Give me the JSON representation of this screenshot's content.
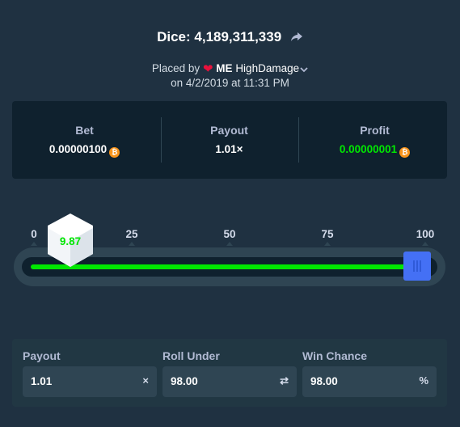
{
  "header": {
    "title": "Dice: 4,189,311,339",
    "placed_prefix": "Placed by",
    "vip_badge": "ME",
    "username": "HighDamage",
    "date_line": "on 4/2/2019 at 11:31 PM"
  },
  "stats": {
    "bet_label": "Bet",
    "bet_value": "0.00000100",
    "payout_label": "Payout",
    "payout_value": "1.01×",
    "profit_label": "Profit",
    "profit_value": "0.00000001",
    "currency_icon": "bitcoin-icon"
  },
  "slider": {
    "ticks": [
      "0",
      "25",
      "50",
      "75",
      "100"
    ],
    "roll_under": 98.0,
    "result": "9.87",
    "win_color": "#00e701",
    "lose_color": "#e9113c"
  },
  "inputs": {
    "payout_label": "Payout",
    "payout_value": "1.01",
    "payout_icon_glyph": "×",
    "roll_under_label": "Roll Under",
    "roll_under_value": "98.00",
    "roll_under_icon_glyph": "⇄",
    "win_chance_label": "Win Chance",
    "win_chance_value": "98.00",
    "win_chance_icon_glyph": "%"
  },
  "colors": {
    "background": "#1f3141",
    "panel": "#0f212e",
    "accent_green": "#00e701",
    "handle_blue": "#4470f5",
    "bitcoin": "#f7931a"
  }
}
